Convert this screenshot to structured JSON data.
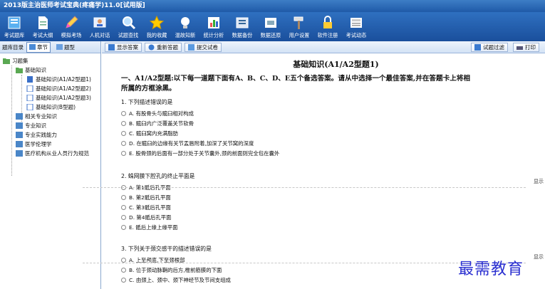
{
  "window": {
    "title": "2013版主治医师考试宝典(疼痛学)11.0[试用版]"
  },
  "toolbar": {
    "items": [
      {
        "label": "考试题库",
        "icon": "book-icon"
      },
      {
        "label": "考试大纲",
        "icon": "document-icon"
      },
      {
        "label": "模拟考场",
        "icon": "pencil-icon"
      },
      {
        "label": "人机对话",
        "icon": "person-icon"
      },
      {
        "label": "试题查找",
        "icon": "magnifier-icon"
      },
      {
        "label": "我的收藏",
        "icon": "star-icon"
      },
      {
        "label": "温故知新",
        "icon": "bulb-icon"
      },
      {
        "label": "统计分析",
        "icon": "chart-icon"
      },
      {
        "label": "数据备份",
        "icon": "backup-icon"
      },
      {
        "label": "数据还原",
        "icon": "restore-icon"
      },
      {
        "label": "用户设置",
        "icon": "hammer-icon"
      },
      {
        "label": "软件注册",
        "icon": "lock-icon"
      },
      {
        "label": "考试动态",
        "icon": "news-icon"
      }
    ]
  },
  "left": {
    "header": "题库目录",
    "tab_chapter": "章节",
    "tab_type": "题型",
    "tree": {
      "root": "习题集",
      "node1": "基础知识",
      "children": [
        "基础知识(A1/A2型题1)",
        "基础知识(A1/A2型题2)",
        "基础知识(A1/A2型题3)",
        "基础知识(B型题)"
      ],
      "others": [
        "相关专业知识",
        "专业知识",
        "专业实践能力",
        "医学伦理学",
        "医疗机构从业人员行为规范"
      ]
    }
  },
  "main": {
    "toolbar": {
      "show_answer": "显示答案",
      "redo": "重新答题",
      "submit": "提交试卷",
      "filter": "试题过滤",
      "print": "打印"
    },
    "title": "基础知识(A1/A2型题1)",
    "instruction_line1": "一、A1/A2型题:以下每一道题下面有A、B、C、D、E五个备选答案。请从中选择一个最佳答案,并在答题卡上将相",
    "instruction_line2": "所属的方框涂黑。",
    "show_label": "显示",
    "questions": [
      {
        "stem": "1. 下列描述错误的是",
        "options": [
          "A. 有股骨头与髋臼相对构成",
          "B. 髋臼内广泛覆盖关节软骨",
          "C. 髋臼窝内充满脂肪",
          "D. 在髋臼的边缘有关节盂唇附着,加深了关节窝的深度",
          "E. 股骨颈的后面有一部分处于关节囊外,颈的前面则完全包在囊外"
        ]
      },
      {
        "stem": "2. 蛛网膜下腔孔的终止平面是",
        "options": [
          "A. 第1骶后孔平面",
          "B. 第2骶后孔平面",
          "C. 第3骶后孔平面",
          "D. 第4骶后孔平面",
          "E. 骶后上缘上缘平面"
        ]
      },
      {
        "stem": "3. 下列关于颈交感干的描述错误的是",
        "options": [
          "A. 上至颅底,下至颈根部",
          "B. 位于颈动脉鞘的后方,椎前筋膜的下面",
          "C. 由颈上、颈中、颈下神经节及节间支组成"
        ]
      }
    ]
  },
  "watermark": "最需教育"
}
